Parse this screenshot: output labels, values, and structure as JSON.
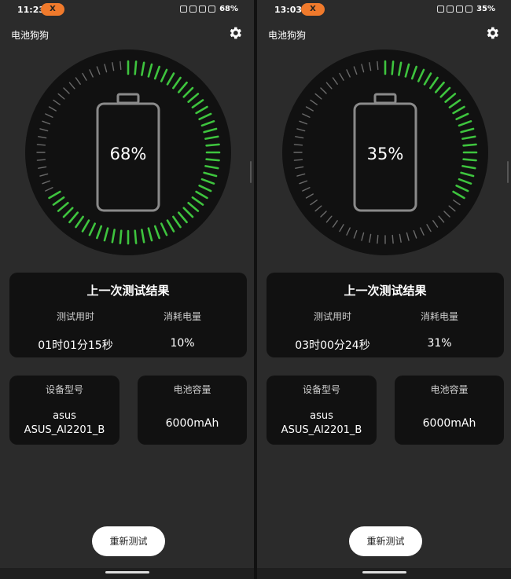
{
  "screens": [
    {
      "status": {
        "time": "11:23",
        "pill": "X",
        "battery_pct": "68%"
      },
      "app_title": "电池狗狗",
      "gauge": {
        "label": "68%",
        "level": 0.68
      },
      "result": {
        "heading": "上一次测试结果",
        "time_label": "测试用时",
        "time_value": "01时01分15秒",
        "usage_label": "消耗电量",
        "usage_value": "10%"
      },
      "device": {
        "label": "设备型号",
        "brand": "asus",
        "model": "ASUS_AI2201_B"
      },
      "capacity": {
        "label": "电池容量",
        "value": "6000mAh"
      },
      "retest_label": "重新测试"
    },
    {
      "status": {
        "time": "13:03",
        "pill": "X",
        "battery_pct": "35%"
      },
      "app_title": "电池狗狗",
      "gauge": {
        "label": "35%",
        "level": 0.35
      },
      "result": {
        "heading": "上一次测试结果",
        "time_label": "测试用时",
        "time_value": "03时00分24秒",
        "usage_label": "消耗电量",
        "usage_value": "31%"
      },
      "device": {
        "label": "设备型号",
        "brand": "asus",
        "model": "ASUS_AI2201_B"
      },
      "capacity": {
        "label": "电池容量",
        "value": "6000mAh"
      },
      "retest_label": "重新测试"
    }
  ],
  "colors": {
    "accent_green": "#3ec43e",
    "tick_dim": "#6a6a6a",
    "card_bg": "#111111",
    "screen_bg": "#2b2b2b",
    "pill": "#f07a2c"
  }
}
